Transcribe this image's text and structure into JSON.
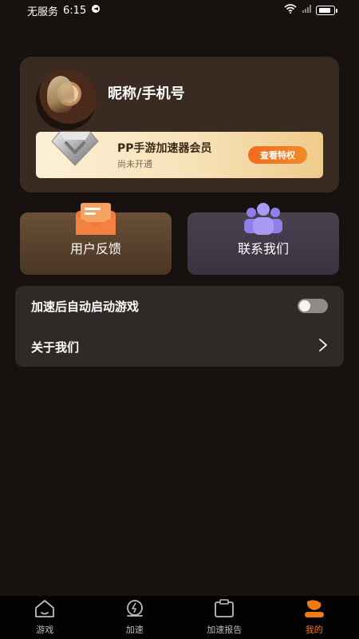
{
  "status_bar": {
    "carrier": "无服务",
    "time": "6:15"
  },
  "profile": {
    "nickname": "昵称/手机号"
  },
  "vip": {
    "title": "PP手游加速器会员",
    "subtitle": "尚未开通",
    "button_label": "查看特权"
  },
  "actions": {
    "feedback_label": "用户反馈",
    "contact_label": "联系我们"
  },
  "settings": {
    "auto_launch_label": "加速后自动启动游戏",
    "auto_launch_enabled": false,
    "about_label": "关于我们"
  },
  "tabs": [
    {
      "label": "游戏",
      "icon": "home-icon",
      "active": false
    },
    {
      "label": "加速",
      "icon": "speed-icon",
      "active": false
    },
    {
      "label": "加速报告",
      "icon": "report-icon",
      "active": false
    },
    {
      "label": "我的",
      "icon": "user-icon",
      "active": true
    }
  ],
  "colors": {
    "accent": "#f07a1a",
    "background": "#17120f"
  }
}
